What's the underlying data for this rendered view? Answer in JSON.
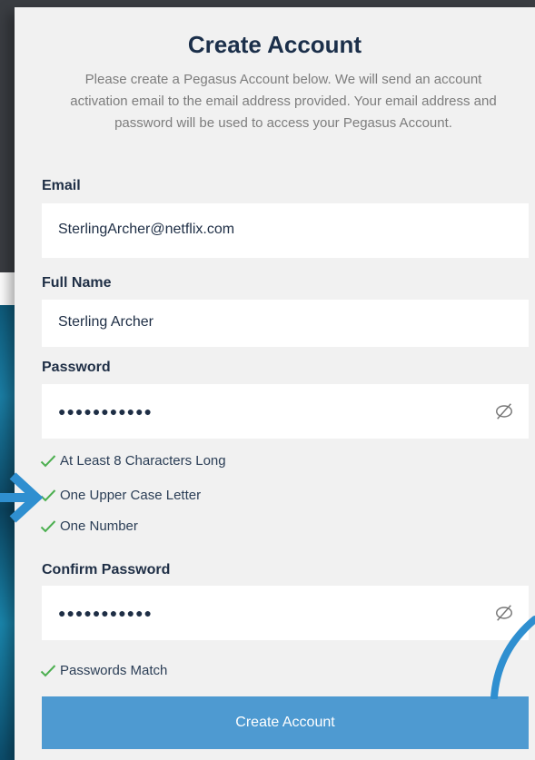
{
  "form": {
    "title": "Create Account",
    "intro": "Please create a Pegasus Account below. We will send an account activation email to the email address provided. Your email address and password will be used to access your Pegasus Account.",
    "email_label": "Email",
    "email_value": "SterlingArcher@netflix.com",
    "fullname_label": "Full Name",
    "fullname_value": "Sterling Archer",
    "password_label": "Password",
    "password_value": "●●●●●●●●●●●",
    "confirm_label": "Confirm Password",
    "confirm_value": "●●●●●●●●●●●",
    "rules": [
      {
        "text": "At Least 8 Characters Long",
        "icon": "check-icon"
      },
      {
        "text": "One Upper Case Letter",
        "icon": "check-icon"
      },
      {
        "text": "One Number",
        "icon": "check-icon"
      }
    ],
    "match_text": "Passwords Match",
    "submit_label": "Create Account"
  },
  "colors": {
    "accent": "#4e9ad1",
    "check_green": "#4caf50",
    "annotation_blue": "#2f8fd0",
    "title": "#1b2f4a"
  }
}
